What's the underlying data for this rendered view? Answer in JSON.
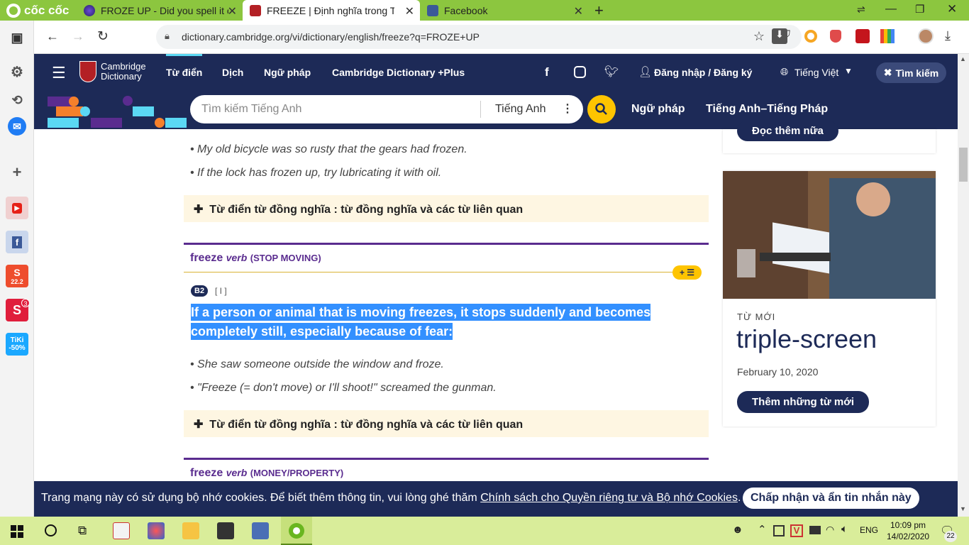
{
  "browser": {
    "brand": "cốc cốc",
    "tabs": [
      {
        "title": "FROZE UP - Did you spell it c",
        "icon": "purple-globe-icon"
      },
      {
        "title": "FREEZE | Định nghĩa trong Từ",
        "icon": "cambridge-shield-icon"
      },
      {
        "title": "Facebook",
        "icon": "facebook-icon"
      }
    ],
    "new_tab": "+",
    "url": "dictionary.cambridge.org/vi/dictionary/english/freeze?q=FROZE+UP"
  },
  "site": {
    "logo_line1": "Cambridge",
    "logo_line2": "Dictionary",
    "nav": [
      "Từ điển",
      "Dịch",
      "Ngữ pháp",
      "Cambridge Dictionary +Plus"
    ],
    "login": "Đăng nhập / Đăng ký",
    "language": "Tiếng Việt",
    "search_btn": "Tìm kiếm",
    "search_placeholder": "Tìm kiếm Tiếng Anh",
    "search_lang": "Tiếng Anh",
    "sub_nav": [
      "Ngữ pháp",
      "Tiếng Anh–Tiếng Pháp"
    ]
  },
  "entry": {
    "examples_top": [
      "My old bicycle was so rusty that the gears had frozen.",
      "If the lock has frozen up, try lubricating it with oil."
    ],
    "thesaurus": "Từ điển từ đồng nghĩa : từ đồng nghĩa và các từ liên quan",
    "sense2": {
      "word": "freeze",
      "pos": "verb",
      "guide": "(STOP MOVING)",
      "level": "B2",
      "grammar": "[ I ]",
      "definition_line1": "If a person or animal that is moving freezes, it stops suddenly and becomes",
      "definition_line2": "completely still, especially because of fear:",
      "examples": [
        "She saw someone outside the window and froze.",
        "\"Freeze (= don't move) or I'll shoot!\" screamed the gunman."
      ]
    },
    "sense3": {
      "word": "freeze",
      "pos": "verb",
      "guide": "(MONEY/PROPERTY)"
    }
  },
  "sidebar_card": {
    "read_more": "Đọc thêm nữa",
    "label": "TỪ MỚI",
    "word": "triple-screen",
    "date": "February 10, 2020",
    "button": "Thêm những từ mới"
  },
  "cookie": {
    "text": "Trang mạng này có sử dụng bộ nhớ cookies. Để biết thêm thông tin, vui lòng ghé thăm ",
    "link": "Chính sách cho Quyền riêng tư và Bộ nhớ Cookies",
    "after": ".",
    "button": "Chấp nhận và ẩn tin nhắn này"
  },
  "taskbar": {
    "lang": "ENG",
    "time": "10:09 pm",
    "date": "14/02/2020",
    "notifications": "22"
  },
  "sidebar_apps": {
    "badge": "3",
    "tiki_line1": "TiKi",
    "tiki_line2": "-50%",
    "shopee_date": "22.2"
  }
}
